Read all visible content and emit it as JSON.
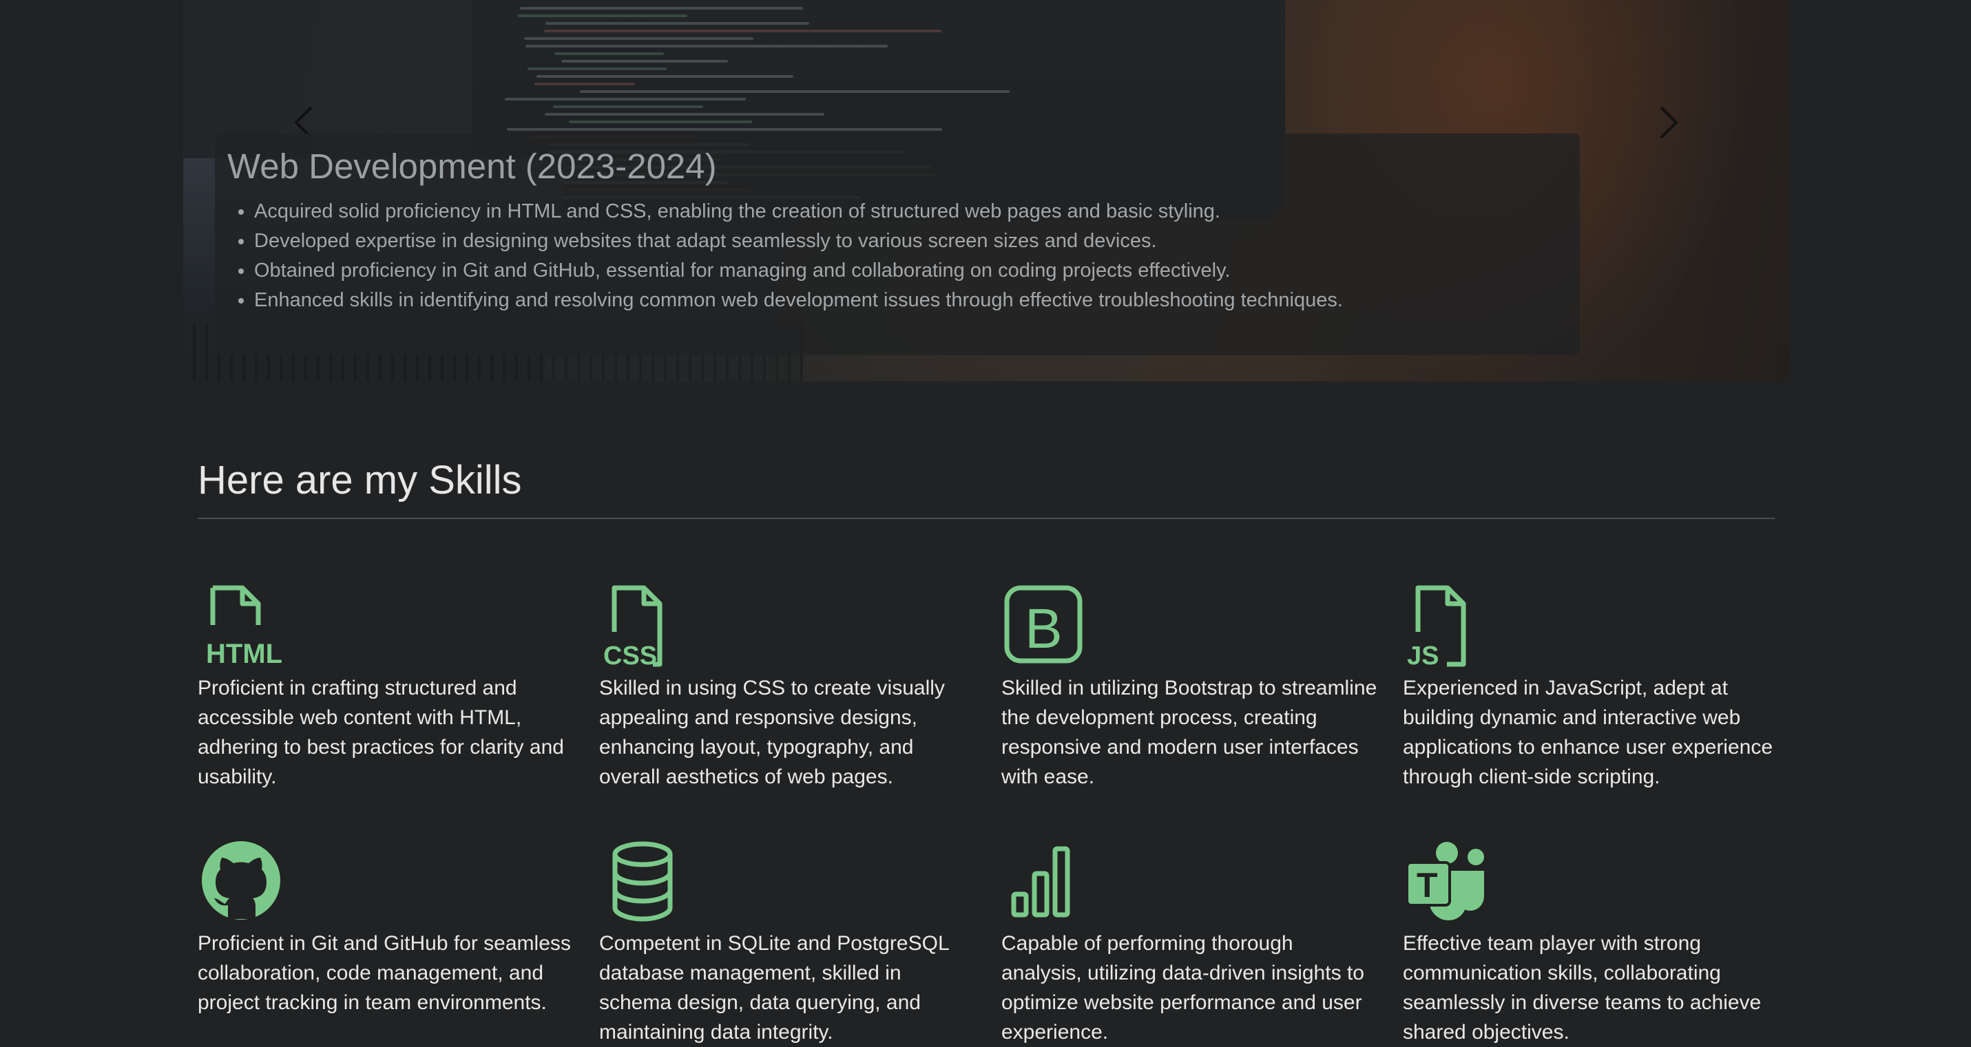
{
  "carousel": {
    "slide_title": "Web Development (2023-2024)",
    "bullets": [
      "Acquired solid proficiency in HTML and CSS, enabling the creation of structured web pages and basic styling.",
      "Developed expertise in designing websites that adapt seamlessly to various screen sizes and devices.",
      "Obtained proficiency in Git and GitHub, essential for managing and collaborating on coding projects effectively.",
      "Enhanced skills in identifying and resolving common web development issues through effective troubleshooting techniques."
    ],
    "prev_icon": "chevron-left-icon",
    "next_icon": "chevron-right-icon"
  },
  "skills": {
    "heading": "Here are my Skills",
    "accent_color": "#7bc98a",
    "items": [
      {
        "icon": "html-file-icon",
        "icon_label": "HTML",
        "text": "Proficient in crafting structured and accessible web content with HTML, adhering to best practices for clarity and usability."
      },
      {
        "icon": "css-file-icon",
        "icon_label": "CSS",
        "text": "Skilled in using CSS to create visually appealing and responsive designs, enhancing layout, typography, and overall aesthetics of web pages."
      },
      {
        "icon": "bootstrap-icon",
        "icon_label": "B",
        "text": "Skilled in utilizing Bootstrap to streamline the development process, creating responsive and modern user interfaces with ease."
      },
      {
        "icon": "js-file-icon",
        "icon_label": "JS",
        "text": "Experienced in JavaScript, adept at building dynamic and interactive web applications to enhance user experience through client-side scripting."
      },
      {
        "icon": "github-icon",
        "text": "Proficient in Git and GitHub for seamless collaboration, code management, and project tracking in team environments."
      },
      {
        "icon": "database-icon",
        "text": "Competent in SQLite and PostgreSQL database management, skilled in schema design, data querying, and maintaining data integrity."
      },
      {
        "icon": "bar-chart-icon",
        "text": "Capable of performing thorough analysis, utilizing data-driven insights to optimize website performance and user experience."
      },
      {
        "icon": "teams-icon",
        "icon_label": "T",
        "text": "Effective team player with strong communication skills, collaborating seamlessly in diverse teams to achieve shared objectives."
      }
    ]
  }
}
